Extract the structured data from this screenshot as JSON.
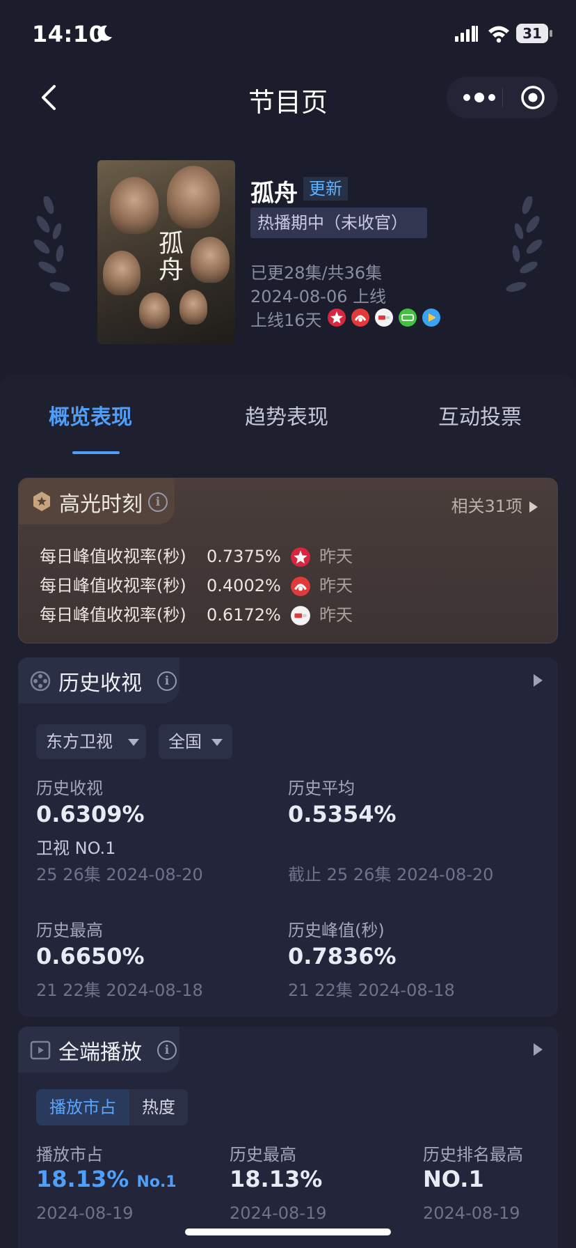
{
  "status_bar": {
    "time": "14:10",
    "battery": "31"
  },
  "nav": {
    "title": "节目页"
  },
  "show": {
    "name": "孤舟",
    "update_badge": "更新",
    "status": "热播期中（未收官）",
    "episodes": "已更28集/共36集",
    "release": "2024-08-06 上线",
    "days_online": "上线16天",
    "poster_text": "孤舟",
    "platforms": [
      "dragon-tv-logo",
      "jiangsu-tv-logo",
      "tencent-video-logo",
      "iqiyi-logo",
      "youku-logo"
    ]
  },
  "tabs": [
    "概览表现",
    "趋势表现",
    "互动投票"
  ],
  "highlights": {
    "title": "高光时刻",
    "related": "相关31项",
    "rows": [
      {
        "label": "每日峰值收视率(秒)",
        "value": "0.7375%",
        "when": "昨天",
        "logo": "dragon-tv-logo"
      },
      {
        "label": "每日峰值收视率(秒)",
        "value": "0.4002%",
        "when": "昨天",
        "logo": "jiangsu-tv-logo"
      },
      {
        "label": "每日峰值收视率(秒)",
        "value": "0.6172%",
        "when": "昨天",
        "logo": "tencent-video-logo"
      }
    ]
  },
  "history": {
    "title": "历史收视",
    "channel": "东方卫视",
    "region": "全国",
    "stats": [
      {
        "label": "历史收视",
        "value": "0.6309%",
        "rank": "卫视 NO.1",
        "sub": "25 26集 2024-08-20"
      },
      {
        "label": "历史平均",
        "value": "0.5354%",
        "sub": "截止 25 26集 2024-08-20"
      },
      {
        "label": "历史最高",
        "value": "0.6650%",
        "sub": "21 22集 2024-08-18"
      },
      {
        "label": "历史峰值(秒)",
        "value": "0.7836%",
        "sub": "21 22集 2024-08-18"
      }
    ]
  },
  "streaming": {
    "title": "全端播放",
    "segments": [
      "播放市占",
      "热度"
    ],
    "stats": [
      {
        "label": "播放市占",
        "value": "18.13%",
        "rank": "No.1",
        "date": "2024-08-19"
      },
      {
        "label": "历史最高",
        "value": "18.13%",
        "date": "2024-08-19"
      },
      {
        "label": "历史排名最高",
        "value": "NO.1",
        "date": "2024-08-19"
      }
    ]
  },
  "colors": {
    "accent": "#4f9ef8",
    "background": "#1b1d2c",
    "card": "#23263a",
    "highlight_card": "#4a3d3a"
  }
}
